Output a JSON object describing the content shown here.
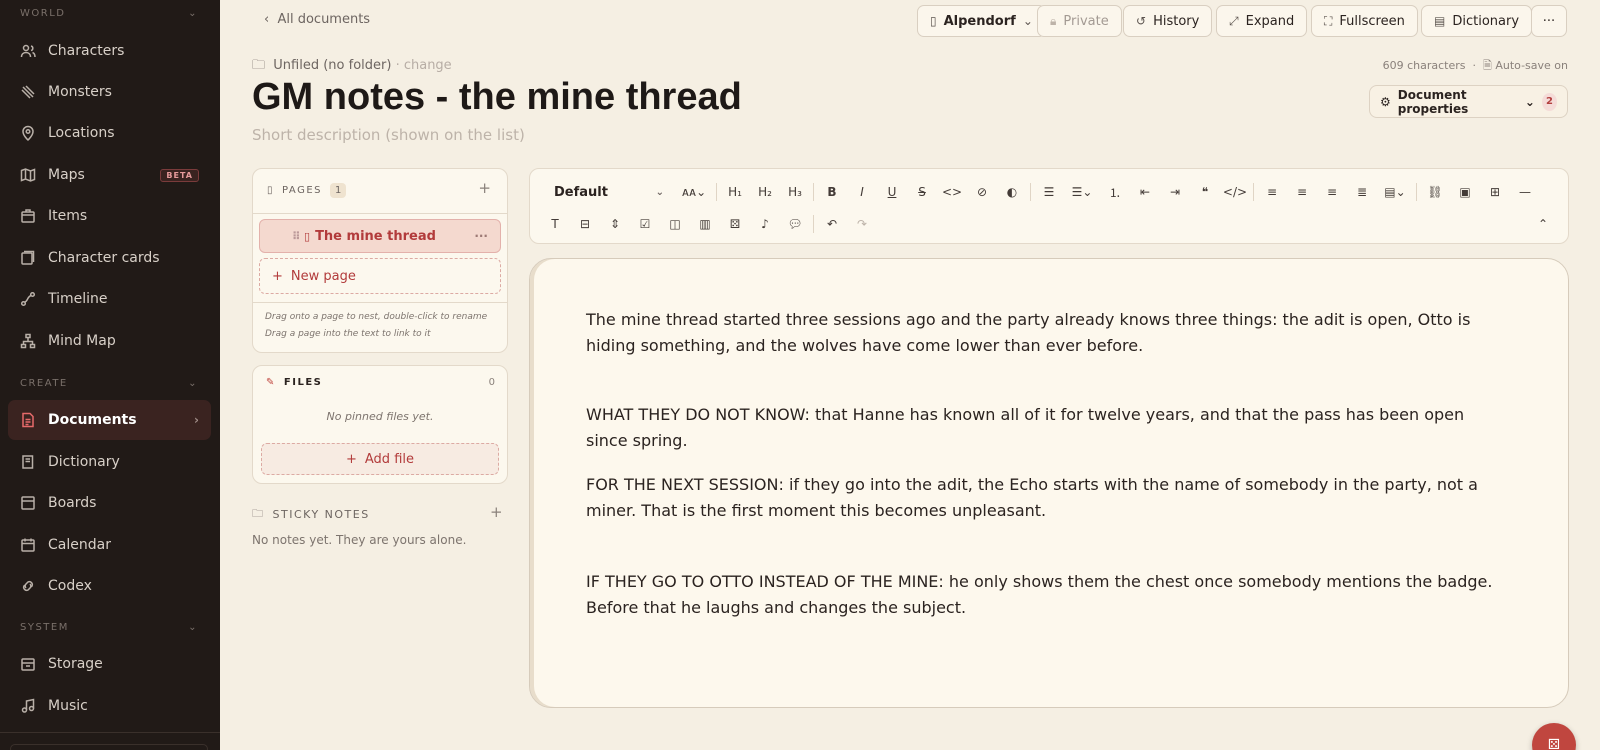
{
  "sidebar": {
    "sections": {
      "world": "WORLD",
      "create": "CREATE",
      "system": "SYSTEM"
    },
    "items": [
      {
        "label": "Characters",
        "icon": "users-icon"
      },
      {
        "label": "Monsters",
        "icon": "claw-icon"
      },
      {
        "label": "Locations",
        "icon": "map-pin-icon"
      },
      {
        "label": "Maps",
        "icon": "map-icon",
        "badge": "BETA"
      },
      {
        "label": "Items",
        "icon": "box-icon"
      },
      {
        "label": "Character cards",
        "icon": "cards-icon"
      },
      {
        "label": "Timeline",
        "icon": "timeline-icon"
      },
      {
        "label": "Mind Map",
        "icon": "network-icon"
      },
      {
        "label": "Documents",
        "icon": "document-icon",
        "active": true
      },
      {
        "label": "Dictionary",
        "icon": "book-icon"
      },
      {
        "label": "Boards",
        "icon": "board-icon"
      },
      {
        "label": "Calendar",
        "icon": "calendar-icon"
      },
      {
        "label": "Codex",
        "icon": "codex-icon"
      },
      {
        "label": "Storage",
        "icon": "storage-icon"
      },
      {
        "label": "Music",
        "icon": "music-icon"
      }
    ]
  },
  "topbar": {
    "back": "All documents",
    "world": "Alpendorf",
    "private": "Private",
    "history": "History",
    "expand": "Expand",
    "fullscreen": "Fullscreen",
    "dictionary": "Dictionary",
    "more": "···"
  },
  "doc": {
    "folder": "Unfiled (no folder)",
    "change": "· change",
    "chars": "609 characters",
    "autosave": "Auto-save on",
    "title": "GM notes - the mine thread",
    "short_desc_placeholder": "Short description (shown on the list)",
    "props_label": "Document properties",
    "props_count": "2"
  },
  "pages": {
    "header": "PAGES",
    "count": "1",
    "items": [
      "The mine thread"
    ],
    "new_page": "New page",
    "hint1": "Drag onto a page to nest, double-click to rename",
    "hint2": "Drag a page into the text to link to it"
  },
  "files": {
    "header": "FILES",
    "count": "0",
    "empty": "No pinned files yet.",
    "add": "Add file"
  },
  "sticky": {
    "header": "STICKY NOTES",
    "empty": "No notes yet. They are yours alone."
  },
  "toolbar": {
    "style": "Default"
  },
  "editor": {
    "paragraphs": [
      "The mine thread started three sessions ago and the party already knows three things: the adit is open, Otto is hiding something, and the wolves have come lower than ever before.",
      "WHAT THEY DO NOT KNOW: that Hanne has known all of it for twelve years, and that the pass has been open since spring.",
      "FOR THE NEXT SESSION: if they go into the adit, the Echo starts with the name of somebody in the party, not a miner. That is the first moment this becomes unpleasant.",
      "IF THEY GO TO OTTO INSTEAD OF THE MINE: he only shows them the chest once somebody mentions the badge. Before that he laughs and changes the subject."
    ]
  },
  "colors": {
    "sidebar_bg": "#211a17",
    "accent": "#b23b3b",
    "page_bg": "#f5efe3"
  }
}
